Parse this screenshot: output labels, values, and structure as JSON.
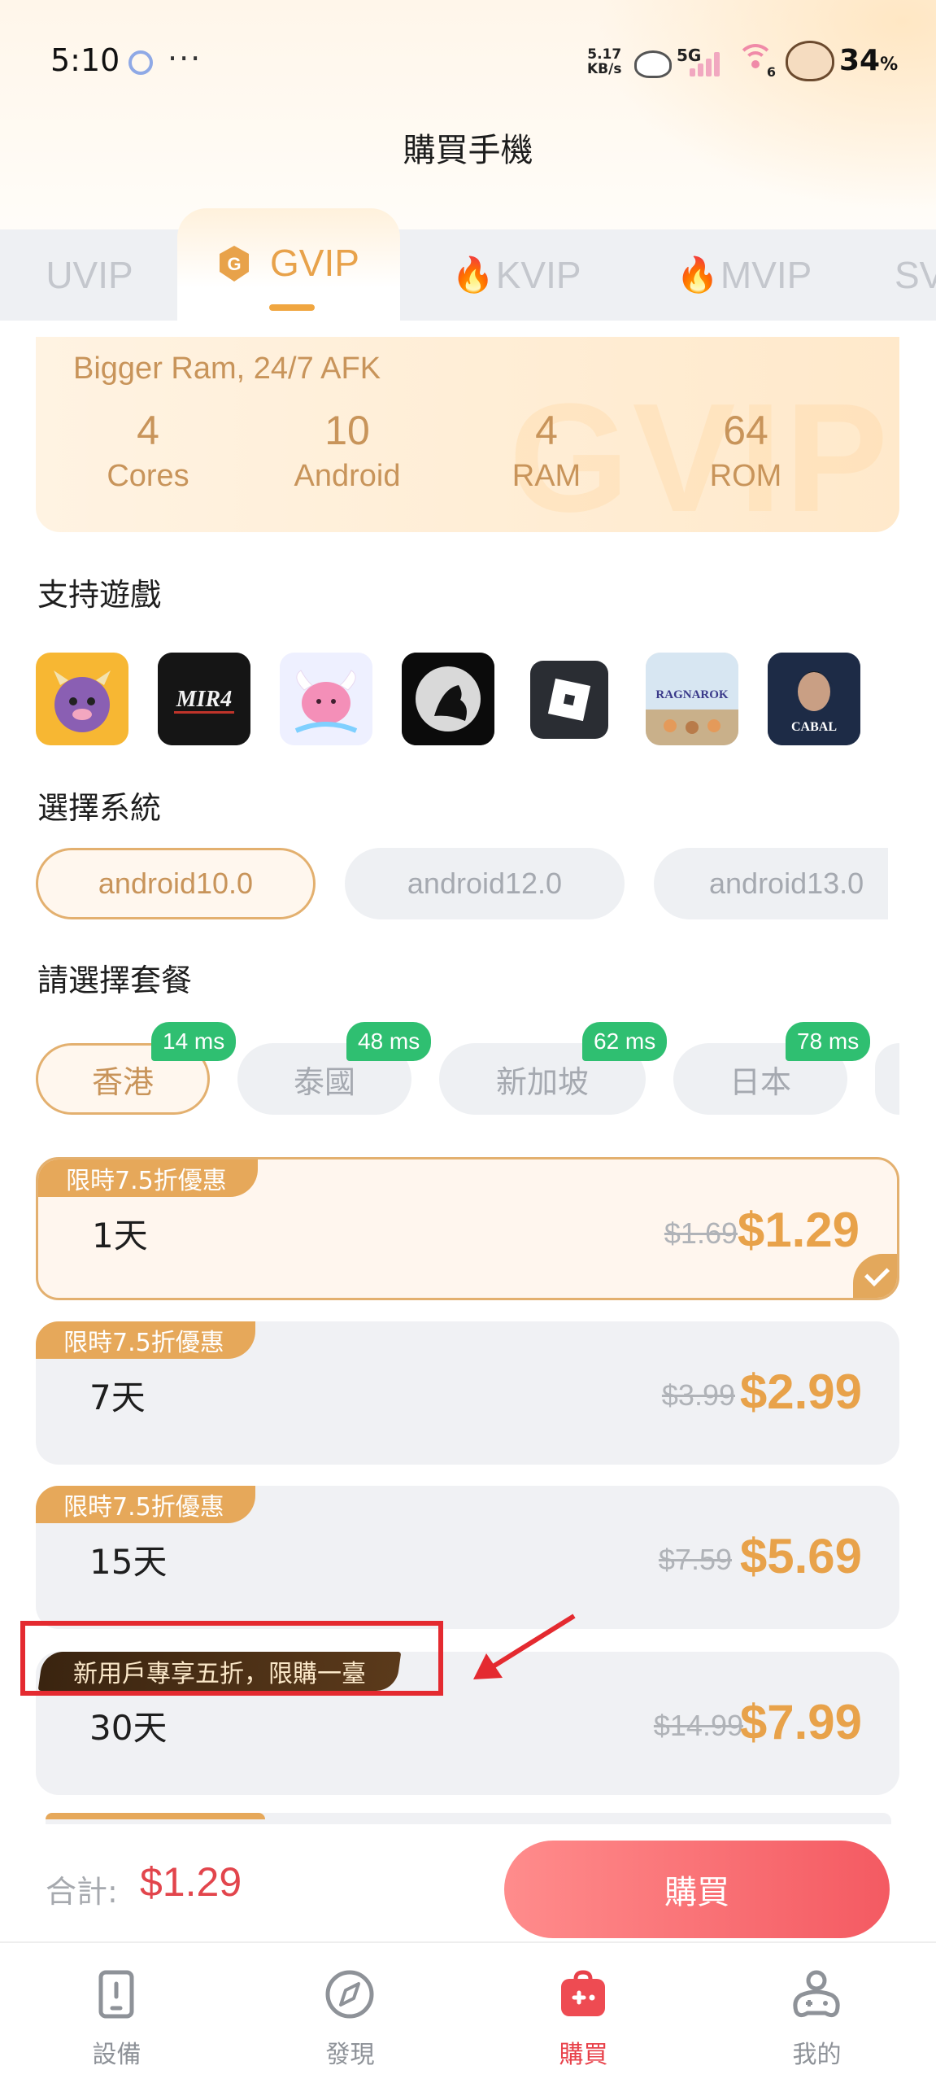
{
  "status_bar": {
    "time": "5:10",
    "more": "···",
    "net_speed_value": "5.17",
    "net_speed_unit": "KB/s",
    "network": "5G",
    "wifi_sub": "6",
    "battery": "34",
    "battery_unit": "%"
  },
  "page": {
    "title": "購買手機"
  },
  "tabs": [
    {
      "label": "UVIP",
      "fire": false
    },
    {
      "label": "GVIP",
      "fire": false,
      "active": true
    },
    {
      "label": "KVIP",
      "fire": true
    },
    {
      "label": "MVIP",
      "fire": true
    },
    {
      "label": "SV",
      "fire": false
    }
  ],
  "spec": {
    "tagline": "Bigger Ram, 24/7 AFK",
    "watermark": "GVIP",
    "items": [
      {
        "value": "4",
        "label": "Cores"
      },
      {
        "value": "10",
        "label": "Android"
      },
      {
        "value": "4",
        "label": "RAM"
      },
      {
        "value": "64",
        "label": "ROM"
      }
    ]
  },
  "games_section": {
    "title": "支持遊戲",
    "games": [
      {
        "icon": "purple-monster-game-icon"
      },
      {
        "icon": "mir4-game-icon",
        "text": "MIR4"
      },
      {
        "icon": "pink-poring-game-icon"
      },
      {
        "icon": "crow-moon-game-icon"
      },
      {
        "icon": "roblox-game-icon"
      },
      {
        "icon": "ragnarok-game-icon",
        "text": "RAGNAROK"
      },
      {
        "icon": "cabal-game-icon",
        "text": "CABAL"
      }
    ]
  },
  "system_section": {
    "title": "選擇系統",
    "options": [
      "android10.0",
      "android12.0",
      "android13.0"
    ],
    "selected": "android10.0"
  },
  "package_section": {
    "title": "請選擇套餐",
    "regions": [
      {
        "name": "香港",
        "ping": "14 ms",
        "selected": true
      },
      {
        "name": "泰國",
        "ping": "48 ms"
      },
      {
        "name": "新加坡",
        "ping": "62 ms"
      },
      {
        "name": "日本",
        "ping": "78 ms"
      }
    ]
  },
  "plans": [
    {
      "badge": "限時7.5折優惠",
      "name": "1天",
      "old_price": "$1.69",
      "price": "$1.29",
      "selected": true
    },
    {
      "badge": "限時7.5折優惠",
      "name": "7天",
      "old_price": "$3.99",
      "price": "$2.99"
    },
    {
      "badge": "限時7.5折優惠",
      "name": "15天",
      "old_price": "$7.59",
      "price": "$5.69"
    },
    {
      "badge": "新用戶專享五折，限購一臺",
      "name": "30天",
      "old_price": "$14.99",
      "price": "$7.99"
    }
  ],
  "footer": {
    "total_label": "合計:",
    "total_value": "$1.29",
    "buy_label": "購買"
  },
  "nav": [
    {
      "label": "設備",
      "icon": "device-icon"
    },
    {
      "label": "發現",
      "icon": "compass-icon"
    },
    {
      "label": "購買",
      "icon": "shop-bag-icon",
      "active": true
    },
    {
      "label": "我的",
      "icon": "profile-gamepad-icon"
    }
  ],
  "colors": {
    "accent_gold": "#e8a24a",
    "price_red": "#e2454c",
    "ping_green": "#2fbf71",
    "annotation_red": "#e42a30"
  }
}
